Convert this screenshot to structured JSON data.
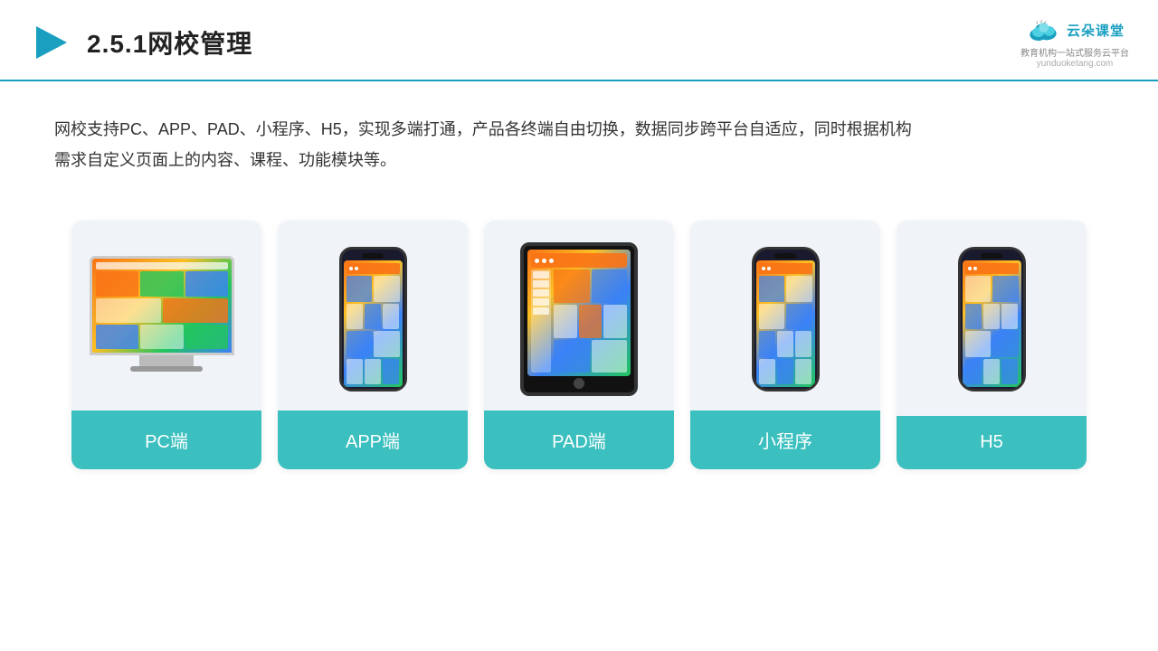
{
  "header": {
    "section_number": "2.5.1",
    "title": "网校管理",
    "logo_name": "云朵课堂",
    "logo_domain": "yunduoketang.com",
    "logo_tagline": "教育机构一站\n式服务云平台"
  },
  "description": {
    "text": "网校支持PC、APP、PAD、小程序、H5，实现多端打通，产品各终端自由切换，数据同步跨平台自适应，同时根据机构\n需求自定义页面上的内容、课程、功能模块等。"
  },
  "cards": [
    {
      "id": "pc",
      "label": "PC端"
    },
    {
      "id": "app",
      "label": "APP端"
    },
    {
      "id": "pad",
      "label": "PAD端"
    },
    {
      "id": "miniprogram",
      "label": "小程序"
    },
    {
      "id": "h5",
      "label": "H5"
    }
  ],
  "colors": {
    "teal": "#3bbfbf",
    "accent_blue": "#1a9fc0",
    "card_bg": "#f0f4f8"
  }
}
